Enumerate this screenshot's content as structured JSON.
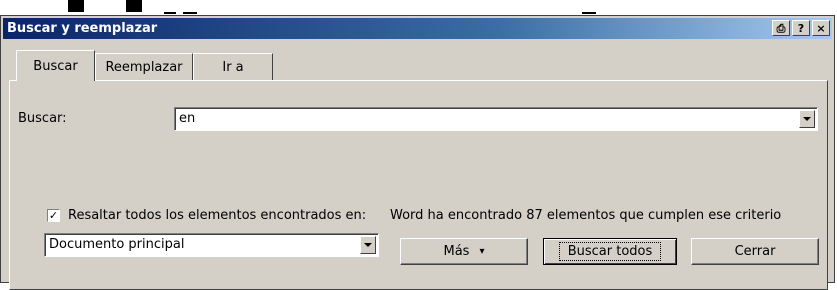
{
  "dialog": {
    "title": "Buscar y reemplazar",
    "titlebar_buttons": [
      {
        "name": "print-icon",
        "label": "⎙"
      },
      {
        "name": "help-icon",
        "label": "?"
      },
      {
        "name": "close-icon",
        "label": "×"
      }
    ]
  },
  "tabs": [
    {
      "label": "Buscar",
      "active": true
    },
    {
      "label": "Reemplazar",
      "active": false
    },
    {
      "label": "Ir a",
      "active": false
    }
  ],
  "find": {
    "label": "Buscar:",
    "value": "en"
  },
  "highlight": {
    "checked": true,
    "label": "Resaltar todos los elementos encontrados en:"
  },
  "scope": {
    "value": "Documento principal"
  },
  "status_text": "Word ha encontrado 87 elementos que cumplen ese criterio",
  "buttons": {
    "more": "Más",
    "more_arrow": "▾",
    "find_all": "Buscar todos",
    "close": "Cerrar"
  },
  "colors": {
    "dialog_bg": "#d4d0c8",
    "titlebar_start": "#0a246a",
    "titlebar_end": "#a6caf0"
  }
}
